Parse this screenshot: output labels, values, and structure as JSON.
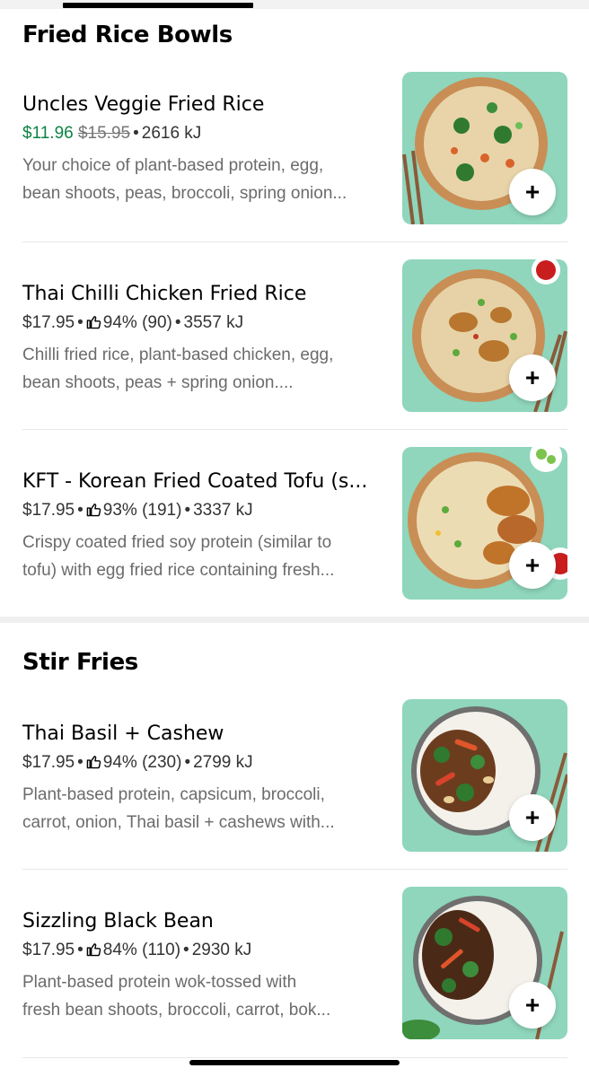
{
  "sections": [
    {
      "title": "Fried Rice Bowls",
      "items": [
        {
          "name": "Uncles Veggie Fried Rice",
          "price": "$11.96",
          "original_price": "$15.95",
          "energy": "2616 kJ",
          "desc_line1": "Your choice of plant-based protein, egg,",
          "desc_line2": "bean shoots, peas, broccoli, spring onion...",
          "add_label": "+"
        },
        {
          "name": "Thai Chilli Chicken Fried Rice",
          "price": "$17.95",
          "rating": "94% (90)",
          "energy": "3557 kJ",
          "desc_line1": "Chilli fried rice, plant-based chicken, egg,",
          "desc_line2": "bean shoots, peas + spring onion....",
          "add_label": "+"
        },
        {
          "name": "KFT - Korean Fried Coated Tofu (s...",
          "price": "$17.95",
          "rating": "93% (191)",
          "energy": "3337 kJ",
          "desc_line1": "Crispy coated fried soy protein (similar to",
          "desc_line2": "tofu) with egg fried rice containing fresh...",
          "add_label": "+"
        }
      ]
    },
    {
      "title": "Stir Fries",
      "items": [
        {
          "name": "Thai Basil + Cashew",
          "price": "$17.95",
          "rating": "94% (230)",
          "energy": "2799 kJ",
          "desc_line1": "Plant-based protein, capsicum, broccoli,",
          "desc_line2": "carrot, onion, Thai basil + cashews with...",
          "add_label": "+"
        },
        {
          "name": "Sizzling Black Bean",
          "price": "$17.95",
          "rating": "84% (110)",
          "energy": "2930 kJ",
          "desc_line1": "Plant-based protein wok-tossed with",
          "desc_line2": "fresh bean shoots, broccoli, carrot, bok...",
          "add_label": "+"
        }
      ]
    }
  ],
  "separator": "•",
  "colors": {
    "sale_price": "#0e8345",
    "photo_background": "#8fd6bc",
    "description": "#6b6b6b"
  },
  "icons": {
    "rating": "thumbs-up-icon",
    "add": "plus-icon"
  }
}
